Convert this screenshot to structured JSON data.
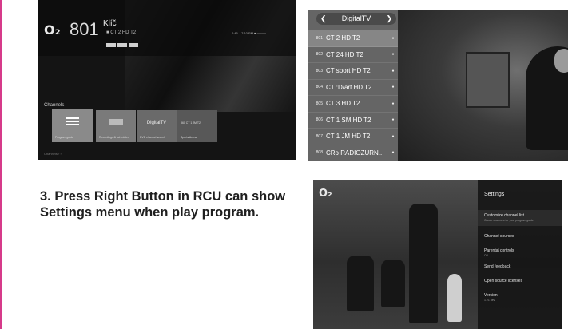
{
  "screenshot1": {
    "logo": "O₂",
    "channel_number": "801",
    "channel_name": "Klíč",
    "channel_sub": "■ CT 2 HD T2",
    "time_text": "4:45 – 7:10 PM  ■ ────",
    "channels_title": "Channels",
    "tiles": [
      {
        "label": "Program guide",
        "icon": "list-icon"
      },
      {
        "label": "Recordings & schedules",
        "icon": "dvb-icon"
      },
      {
        "label": "DVB channel search",
        "text": "DigitalTV"
      },
      {
        "label": "Sports Arena",
        "text": "860 CT 1 JM T2"
      }
    ],
    "bottom_note": "Channels ›  ›"
  },
  "screenshot2": {
    "header": "DigitalTV",
    "channels": [
      {
        "num": "801",
        "name": "CT 2 HD T2"
      },
      {
        "num": "802",
        "name": "CT 24 HD T2"
      },
      {
        "num": "803",
        "name": "CT sport HD T2"
      },
      {
        "num": "804",
        "name": "CT :D/art HD T2"
      },
      {
        "num": "805",
        "name": "CT 3 HD T2"
      },
      {
        "num": "806",
        "name": "CT 1 SM HD T2"
      },
      {
        "num": "807",
        "name": "CT 1 JM HD T2"
      },
      {
        "num": "808",
        "name": "CRo RADIOZURN.."
      }
    ]
  },
  "instruction": "3. Press Right Button in RCU can show Settings menu when play program.",
  "screenshot3": {
    "logo": "O₂",
    "settings_title": "Settings",
    "items": [
      {
        "label": "Customize channel list",
        "sub": "Create channels for your program guide"
      },
      {
        "label": "Channel sources",
        "sub": ""
      },
      {
        "label": "Parental controls",
        "sub": "Off"
      },
      {
        "label": "Send feedback",
        "sub": ""
      },
      {
        "label": "Open source licenses",
        "sub": ""
      },
      {
        "label": "Version",
        "sub": "1.21 dev"
      }
    ]
  },
  "colors": {
    "accent": "#d63a8a",
    "text": "#1f1f1f"
  }
}
